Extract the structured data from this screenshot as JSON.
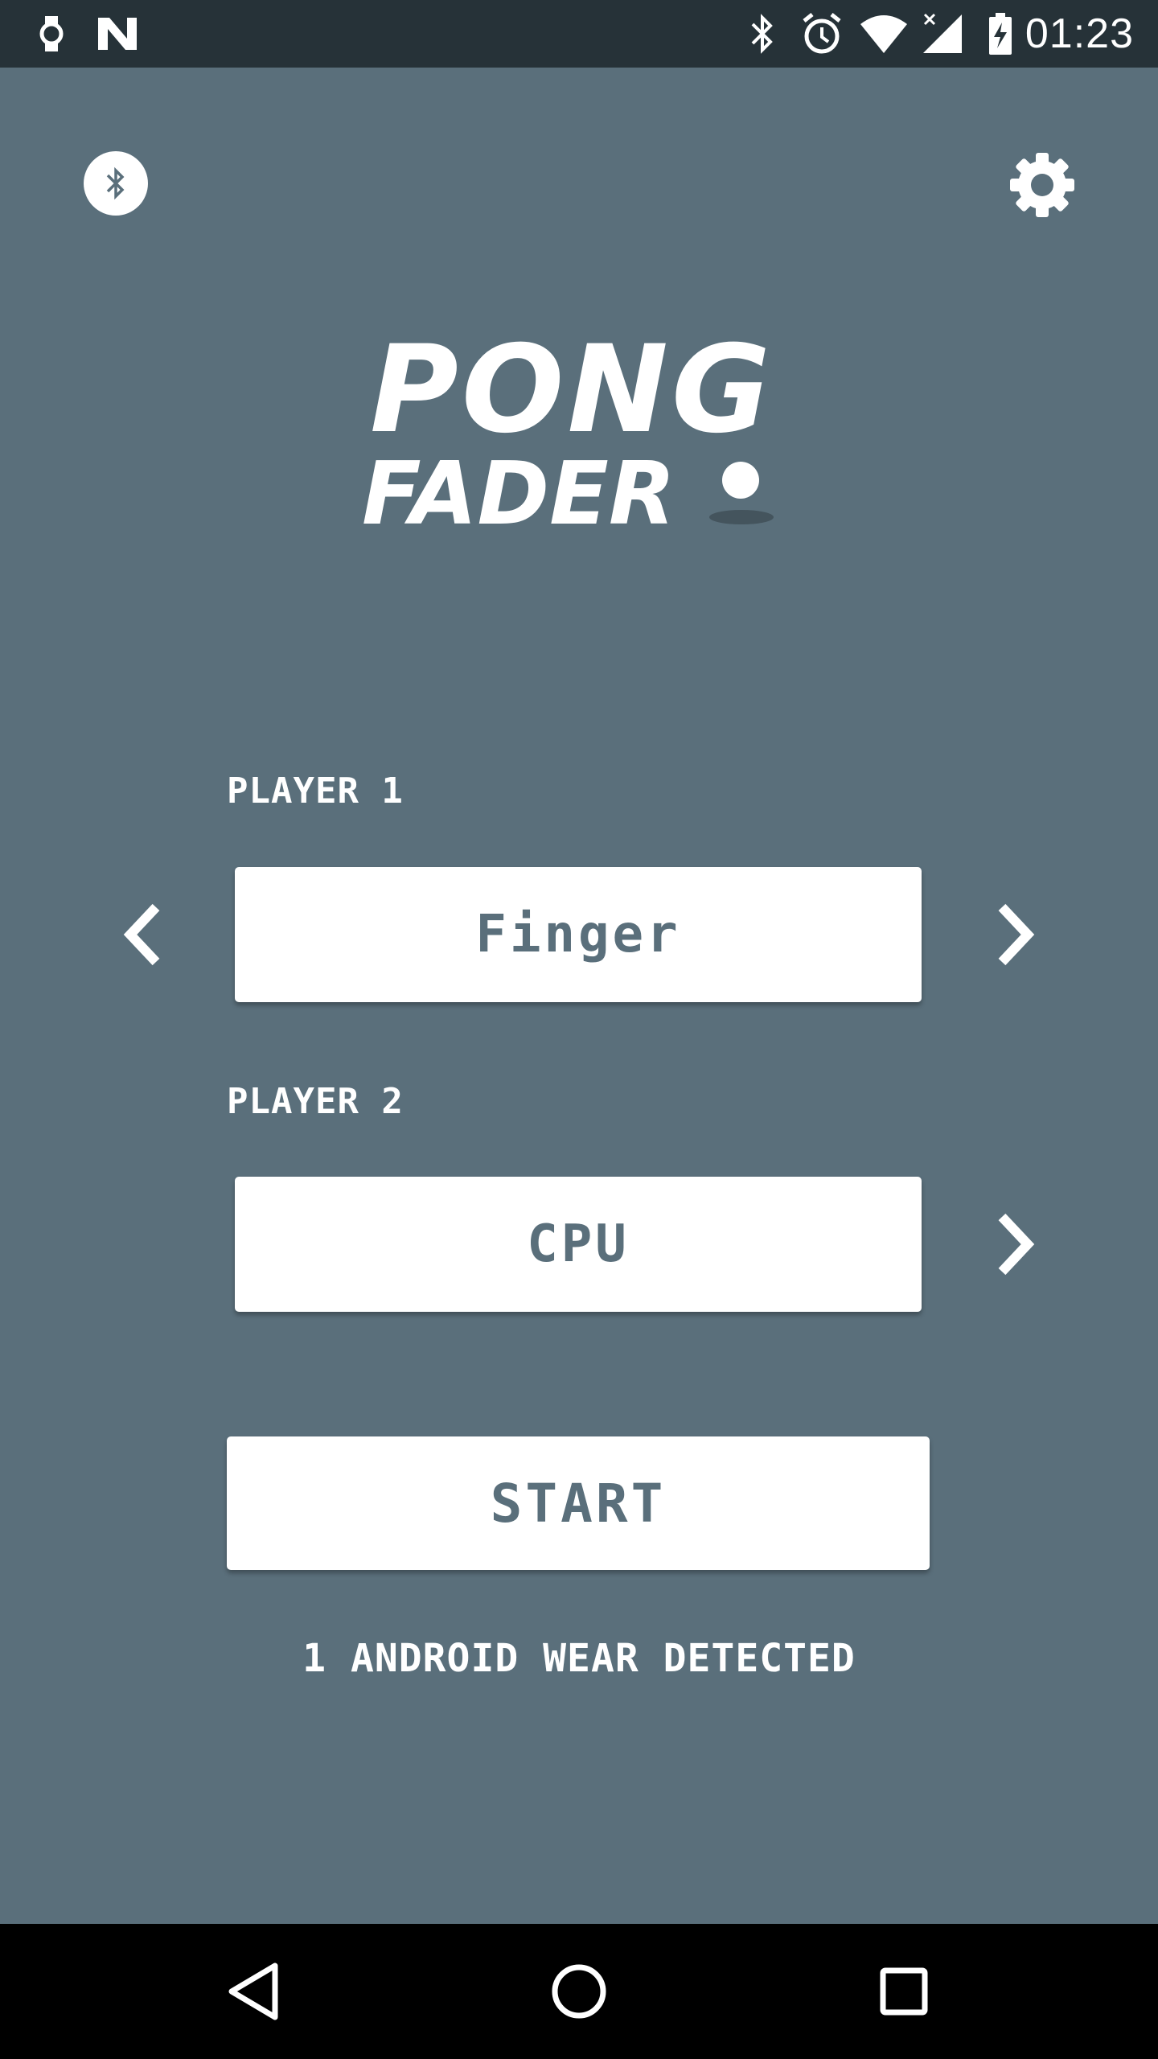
{
  "status_bar": {
    "time": "01:23",
    "icons": [
      "watch-icon",
      "n-logo-icon",
      "bluetooth-icon",
      "alarm-icon",
      "wifi-icon",
      "signal-icon",
      "battery-charging-icon"
    ]
  },
  "header": {
    "bluetooth_icon": "bluetooth-icon",
    "settings_icon": "gear-icon"
  },
  "logo": {
    "line1": "PONG",
    "line2": "FADER"
  },
  "player1": {
    "label": "PLAYER 1",
    "value": "Finger"
  },
  "player2": {
    "label": "PLAYER 2",
    "value": "CPU"
  },
  "start_label": "START",
  "wear_status": "1 ANDROID WEAR DETECTED",
  "colors": {
    "background": "#5a6f7b",
    "status_bar": "#263238",
    "nav_bar": "#000000",
    "button_bg": "#ffffff",
    "button_text": "#5a6f7b"
  }
}
